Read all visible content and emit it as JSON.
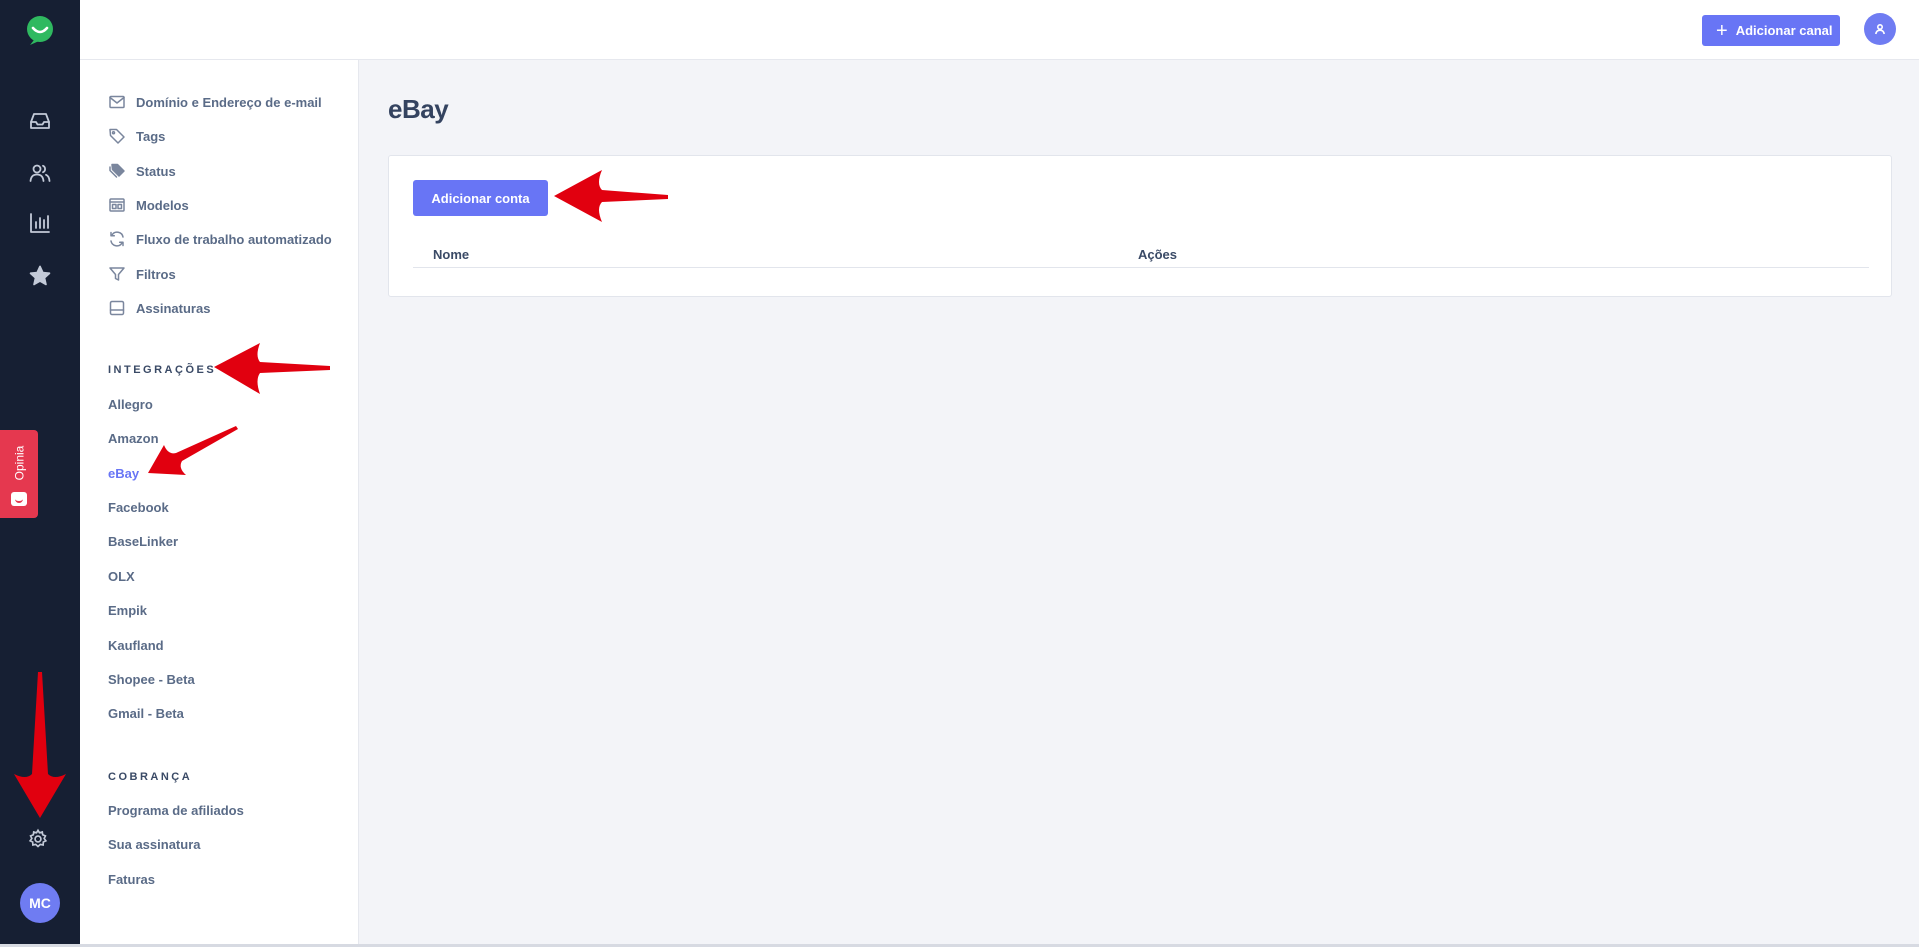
{
  "topbar": {
    "add_channel_label": "Adicionar canal"
  },
  "rail": {
    "icons": [
      "inbox-icon",
      "contacts-icon",
      "reports-icon",
      "favorites-icon"
    ],
    "settings_icon": "gear-icon",
    "avatar_initials": "MC"
  },
  "feedback": {
    "label": "Opinia"
  },
  "settings_nav": {
    "general_items": [
      {
        "label": "Domínio e Endereço de e-mail",
        "icon": "mail-icon"
      },
      {
        "label": "Tags",
        "icon": "tag-icon"
      },
      {
        "label": "Status",
        "icon": "status-tags-icon"
      },
      {
        "label": "Modelos",
        "icon": "templates-icon"
      },
      {
        "label": "Fluxo de trabalho automatizado",
        "icon": "refresh-icon"
      },
      {
        "label": "Filtros",
        "icon": "filter-icon"
      },
      {
        "label": "Assinaturas",
        "icon": "signature-icon"
      }
    ],
    "integrations_title": "INTEGRAÇÕES",
    "integrations": [
      "Allegro",
      "Amazon",
      "eBay",
      "Facebook",
      "BaseLinker",
      "OLX",
      "Empik",
      "Kaufland",
      "Shopee - Beta",
      "Gmail - Beta"
    ],
    "active_integration": "eBay",
    "billing_title": "COBRANÇA",
    "billing": [
      "Programa de afiliados",
      "Sua assinatura",
      "Faturas"
    ]
  },
  "main": {
    "title": "eBay",
    "add_account_label": "Adicionar conta",
    "table_columns": [
      "Nome",
      "Ações"
    ]
  },
  "colors": {
    "accent": "#6875f5",
    "rail": "#161f33",
    "brand_green": "#2fb960",
    "feedback_red": "#e5384f",
    "annotation_red": "#e1000f"
  }
}
